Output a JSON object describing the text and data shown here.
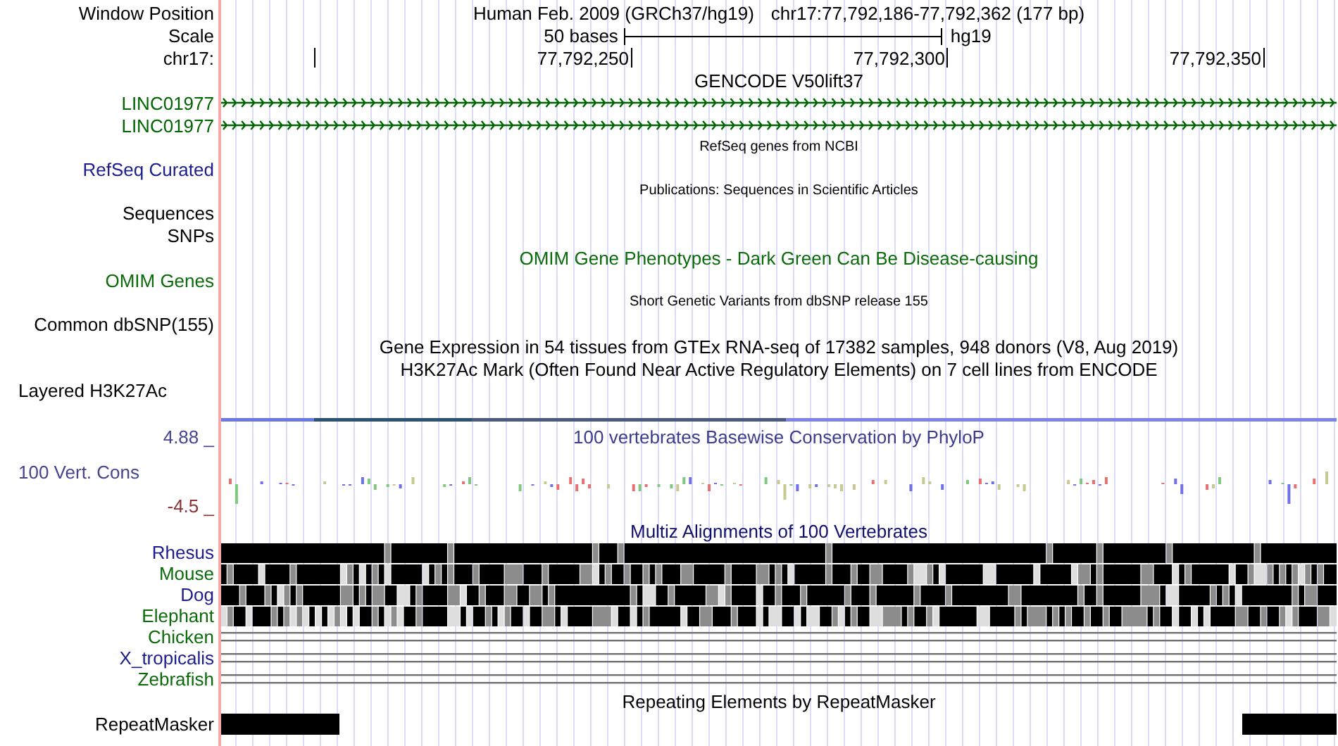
{
  "header": {
    "label": "Window Position",
    "assembly": "Human Feb. 2009 (GRCh37/hg19)",
    "position": "chr17:77,792,186-77,792,362 (177 bp)"
  },
  "scale": {
    "label": "Scale",
    "length": "50 bases",
    "database": "hg19"
  },
  "ruler": {
    "label": "chr17:",
    "ticks": [
      "77,792,250",
      "77,792,300",
      "77,792,350"
    ]
  },
  "tracks": [
    {
      "kind": "title",
      "text": "GENCODE V50lift37",
      "color": "#000000"
    },
    {
      "kind": "gene",
      "label": "LINC01977",
      "color": "#006400"
    },
    {
      "kind": "gene",
      "label": "LINC01977",
      "color": "#006400"
    },
    {
      "kind": "caption",
      "text": "RefSeq genes from NCBI",
      "color": "#000000"
    },
    {
      "kind": "label",
      "label": "RefSeq Curated",
      "color": "#1c1c8c"
    },
    {
      "kind": "caption",
      "text": "Publications: Sequences in Scientific Articles",
      "color": "#000000"
    },
    {
      "kind": "label",
      "label": "Sequences",
      "color": "#000000"
    },
    {
      "kind": "label",
      "label": "SNPs",
      "color": "#000000"
    },
    {
      "kind": "title",
      "text": "OMIM Gene Phenotypes - Dark Green Can Be Disease-causing",
      "color": "#0b6b0b"
    },
    {
      "kind": "label",
      "label": "OMIM Genes",
      "color": "#0b6b0b"
    },
    {
      "kind": "caption",
      "text": "Short Genetic Variants from dbSNP release 155",
      "color": "#000000"
    },
    {
      "kind": "label",
      "label": "Common dbSNP(155)",
      "color": "#000000"
    },
    {
      "kind": "title",
      "text": "Gene Expression in 54 tissues from GTEx RNA-seq of 17382 samples, 948 donors (V8, Aug 2019)",
      "color": "#000000"
    },
    {
      "kind": "title",
      "text": "H3K27Ac Mark (Often Found Near Active Regulatory Elements) on 7 cell lines from ENCODE",
      "color": "#000000"
    },
    {
      "kind": "signal",
      "label": "Layered H3K27Ac"
    },
    {
      "kind": "conservation",
      "label": "100 Vert. Cons",
      "max": "4.88 _",
      "min": "-4.5 _",
      "title": "100 vertebrates Basewise Conservation by PhyloP"
    },
    {
      "kind": "title",
      "text": "Multiz Alignments of 100 Vertebrates",
      "color": "#10106b"
    },
    {
      "kind": "alignment",
      "label": "Rhesus",
      "color": "#1c1c8c"
    },
    {
      "kind": "alignment",
      "label": "Mouse",
      "color": "#0b6b0b"
    },
    {
      "kind": "alignment",
      "label": "Dog",
      "color": "#1c1c8c"
    },
    {
      "kind": "alignment",
      "label": "Elephant",
      "color": "#0b6b0b"
    },
    {
      "kind": "unaligned",
      "label": "Chicken",
      "color": "#0b6b0b"
    },
    {
      "kind": "unaligned",
      "label": "X_tropicalis",
      "color": "#1c1c8c"
    },
    {
      "kind": "unaligned",
      "label": "Zebrafish",
      "color": "#0b6b0b"
    },
    {
      "kind": "title",
      "text": "Repeating Elements by RepeatMasker",
      "color": "#000000"
    },
    {
      "kind": "repeat",
      "label": "RepeatMasker"
    }
  ]
}
